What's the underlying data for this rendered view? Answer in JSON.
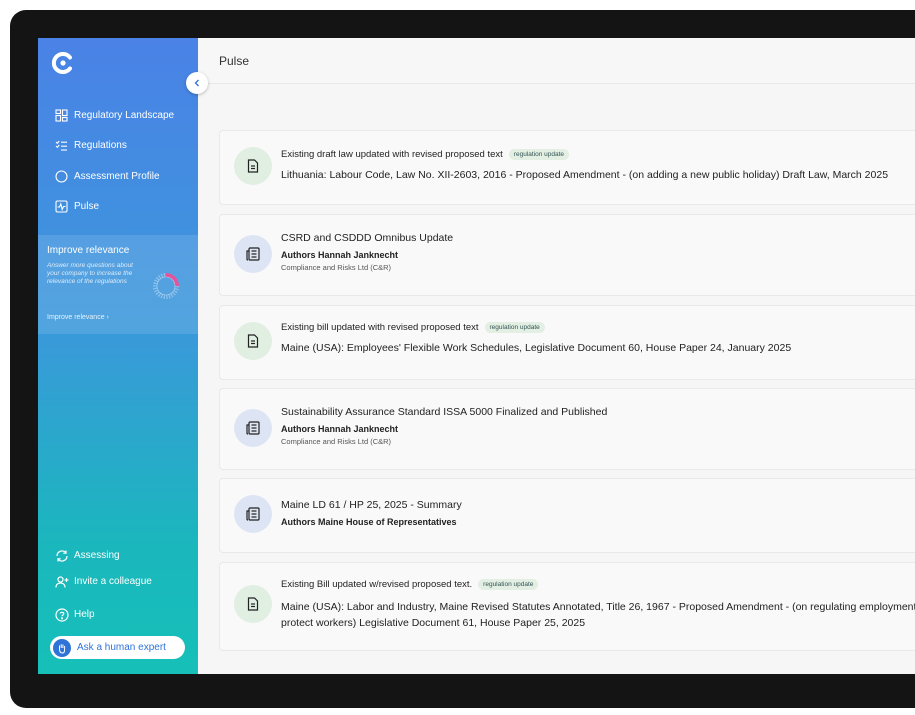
{
  "sidebar": {
    "nav": [
      {
        "label": "Regulatory Landscape",
        "icon": "dashboard-grid-icon"
      },
      {
        "label": "Regulations",
        "icon": "checklist-icon"
      },
      {
        "label": "Assessment Profile",
        "icon": "circle-icon"
      },
      {
        "label": "Pulse",
        "icon": "pulse-icon"
      }
    ],
    "improve": {
      "title": "Improve relevance",
      "text": "Answer more questions about your company to increase the relevance of the regulations",
      "link": "Improve relevance",
      "progress": 0.25
    },
    "bottom": [
      {
        "label": "Assessing",
        "icon": "sync-icon"
      },
      {
        "label": "Invite a colleague",
        "icon": "add-user-icon"
      },
      {
        "label": "Help",
        "icon": "help-icon"
      }
    ],
    "ask_expert": "Ask a human expert"
  },
  "header": {
    "title": "Pulse"
  },
  "feed": [
    {
      "kind": "regulation",
      "headline": "Existing draft law updated with revised proposed text",
      "badge": "regulation update",
      "title": "Lithuania: Labour Code, Law No. XII-2603, 2016 - Proposed Amendment - (on adding a new public holiday) Draft Law, March 2025"
    },
    {
      "kind": "news",
      "title": "CSRD and CSDDD Omnibus Update",
      "authors": "Authors Hannah Janknecht",
      "org": "Compliance and Risks Ltd (C&R)"
    },
    {
      "kind": "regulation",
      "headline": "Existing bill updated with revised proposed text",
      "badge": "regulation update",
      "title": "Maine (USA): Employees' Flexible Work Schedules, Legislative Document 60, House Paper 24, January 2025"
    },
    {
      "kind": "news",
      "title": "Sustainability Assurance Standard ISSA 5000 Finalized and Published",
      "authors": "Authors Hannah Janknecht",
      "org": "Compliance and Risks Ltd (C&R)"
    },
    {
      "kind": "news",
      "title": "Maine LD 61 / HP 25, 2025 - Summary",
      "authors": "Authors Maine House of Representatives"
    },
    {
      "kind": "regulation",
      "headline": "Existing Bill updated w/revised proposed text.",
      "badge": "regulation update",
      "title_line1": "Maine (USA): Labor and Industry, Maine Revised Statutes Annotated, Title 26, 1967 - Proposed Amendment - (on regulating employment to",
      "title_line2": "protect workers) Legislative Document 61, House Paper 25, 2025"
    }
  ]
}
